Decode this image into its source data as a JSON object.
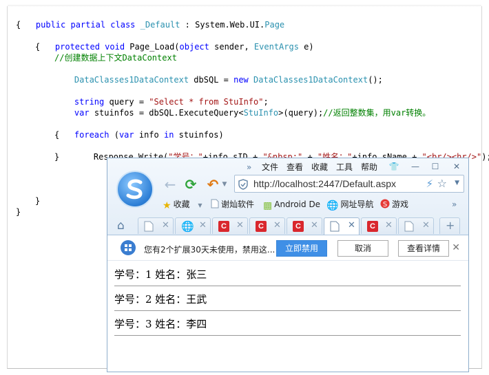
{
  "code": {
    "line1": [
      "public partial class ",
      "_Default",
      " : System.Web.UI.",
      "Page"
    ],
    "line2": "{",
    "line3": [
      "protected void ",
      "Page_Load(",
      "object",
      " sender, ",
      "EventArgs",
      " e)"
    ],
    "line4": "{",
    "line5": "//创建数据上下文DataContext",
    "line6": [
      "DataClasses1DataContext",
      " dbSQL = ",
      "new ",
      "DataClasses1DataContext",
      "();"
    ],
    "line7": [
      "string",
      " query = ",
      "\"Select * from StuInfo\"",
      ";"
    ],
    "line8": [
      "var",
      " stuinfos = dbSQL.ExecuteQuery<",
      "StuInfo",
      ">(query);",
      "//返回整数集，用var转换。"
    ],
    "line9": [
      "foreach",
      " (",
      "var",
      " info ",
      "in",
      " stuinfos)"
    ],
    "line10": "{",
    "line11": [
      "Response.Write(",
      "\"学号：\"",
      "+info.sID + ",
      "\"&nbsp;\"",
      " + ",
      "\"姓名：\"",
      "+info.sName + ",
      "\"<br/><hr/>\"",
      ");"
    ],
    "line12": "}",
    "line13": "}",
    "line14": "}"
  },
  "browser": {
    "menu": {
      "more": "»",
      "file": "文件",
      "view": "查看",
      "favorites": "收藏",
      "tools": "工具",
      "help": "帮助"
    },
    "window_buttons": {
      "skin": "👕",
      "minimize": "—",
      "maximize": "☐",
      "close": "✕"
    },
    "address": "http://localhost:2447/Default.aspx",
    "bookmarks": {
      "favorites": "收藏",
      "item1": "谢灿软件",
      "item2": "Android De",
      "item3": "网址导航",
      "item4": "游戏",
      "more": "»"
    },
    "tabs": {
      "close": "✕",
      "c_label": "C",
      "new_tab": "+"
    },
    "notification": {
      "text": "您有2个扩展30天未使用，禁用这...",
      "disable": "立即禁用",
      "cancel": "取消",
      "details": "查看详情",
      "close": "✕"
    },
    "content": [
      "学号：1 姓名：张三",
      "学号：2 姓名：王武",
      "学号：3 姓名：李四"
    ]
  },
  "colors": {
    "keyword": "#0000ff",
    "type": "#2b91af",
    "string": "#a31515",
    "comment": "#008000",
    "disable_button": "#3f8fe6"
  }
}
